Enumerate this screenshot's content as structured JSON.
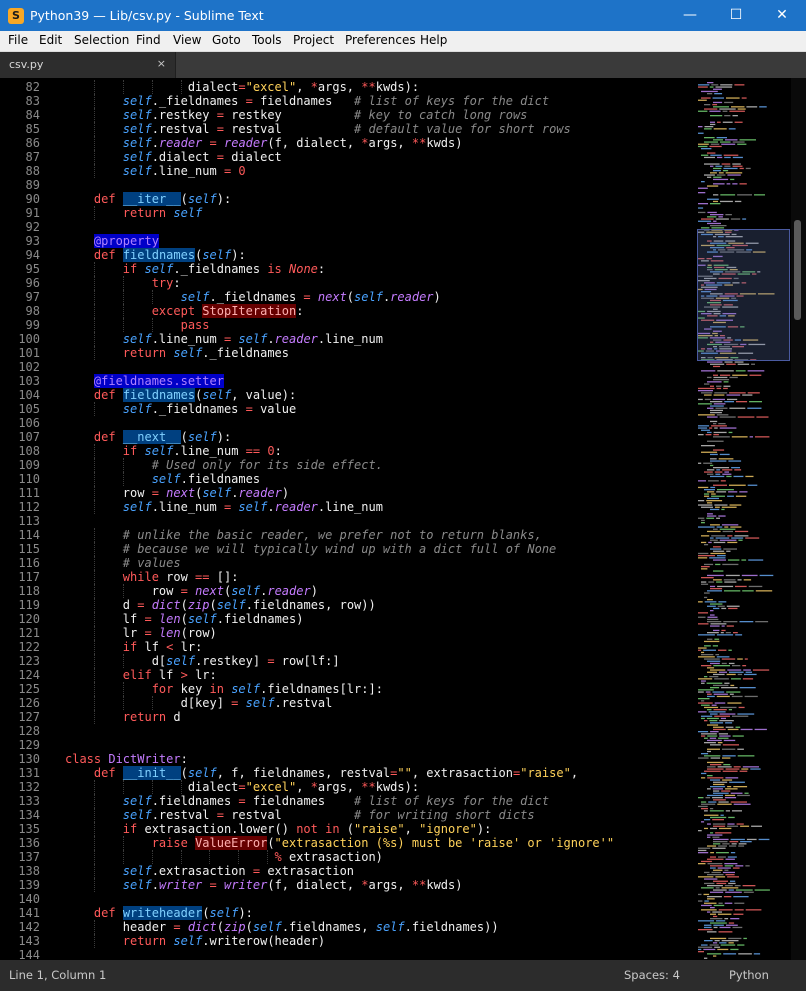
{
  "window": {
    "title": "Python39 — Lib/csv.py - Sublime Text",
    "app_icon": "S",
    "controls": {
      "minimize": "—",
      "maximize": "☐",
      "close": "✕"
    }
  },
  "menu": [
    "File",
    "Edit",
    "Selection",
    "Find",
    "View",
    "Goto",
    "Tools",
    "Project",
    "Preferences",
    "Help"
  ],
  "tab": {
    "label": "csv.py",
    "close": "×"
  },
  "code": {
    "line_numbers": [
      82,
      83,
      84,
      85,
      86,
      87,
      88,
      89,
      90,
      91,
      92,
      93,
      94,
      95,
      96,
      97,
      98,
      99,
      100,
      101,
      102,
      103,
      104,
      105,
      106,
      107,
      108,
      109,
      110,
      111,
      112,
      113,
      114,
      115,
      116,
      117,
      118,
      119,
      120,
      121,
      122,
      123,
      124,
      125,
      126,
      127,
      128,
      129,
      130,
      131,
      132,
      133,
      134,
      135,
      136,
      137,
      138,
      139,
      140,
      141,
      142,
      143,
      144
    ],
    "lines": [
      "                 dialect=\"excel\", *args, **kwds):",
      "        self._fieldnames = fieldnames   # list of keys for the dict",
      "        self.restkey = restkey          # key to catch long rows",
      "        self.restval = restval          # default value for short rows",
      "        self.reader = reader(f, dialect, *args, **kwds)",
      "        self.dialect = dialect",
      "        self.line_num = 0",
      "",
      "    def __iter__(self):",
      "        return self",
      "",
      "    @property",
      "    def fieldnames(self):",
      "        if self._fieldnames is None:",
      "            try:",
      "                self._fieldnames = next(self.reader)",
      "            except StopIteration:",
      "                pass",
      "        self.line_num = self.reader.line_num",
      "        return self._fieldnames",
      "",
      "    @fieldnames.setter",
      "    def fieldnames(self, value):",
      "        self._fieldnames = value",
      "",
      "    def __next__(self):",
      "        if self.line_num == 0:",
      "            # Used only for its side effect.",
      "            self.fieldnames",
      "        row = next(self.reader)",
      "        self.line_num = self.reader.line_num",
      "",
      "        # unlike the basic reader, we prefer not to return blanks,",
      "        # because we will typically wind up with a dict full of None",
      "        # values",
      "        while row == []:",
      "            row = next(self.reader)",
      "        d = dict(zip(self.fieldnames, row))",
      "        lf = len(self.fieldnames)",
      "        lr = len(row)",
      "        if lf < lr:",
      "            d[self.restkey] = row[lf:]",
      "        elif lf > lr:",
      "            for key in self.fieldnames[lr:]:",
      "                d[key] = self.restval",
      "        return d",
      "",
      "",
      "class DictWriter:",
      "    def __init__(self, f, fieldnames, restval=\"\", extrasaction=\"raise\",",
      "                 dialect=\"excel\", *args, **kwds):",
      "        self.fieldnames = fieldnames    # list of keys for the dict",
      "        self.restval = restval          # for writing short dicts",
      "        if extrasaction.lower() not in (\"raise\", \"ignore\"):",
      "            raise ValueError(\"extrasaction (%s) must be 'raise' or 'ignore'\"",
      "                             % extrasaction)",
      "        self.extrasaction = extrasaction",
      "        self.writer = writer(f, dialect, *args, **kwds)",
      "",
      "    def writeheader(self):",
      "        header = dict(zip(self.fieldnames, self.fieldnames))",
      "        return self.writerow(header)",
      ""
    ]
  },
  "status": {
    "position": "Line 1, Column 1",
    "indent": "Spaces: 4",
    "syntax": "Python"
  }
}
